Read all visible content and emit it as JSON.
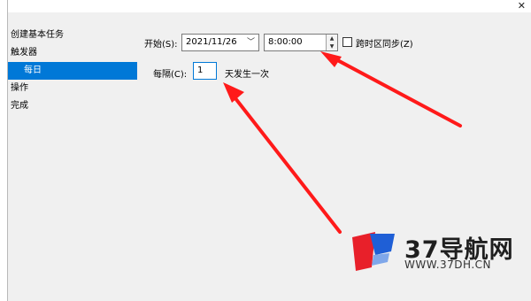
{
  "wizard": {
    "steps": [
      {
        "label": "创建基本任务"
      },
      {
        "label": "触发器"
      },
      {
        "label": "每日"
      },
      {
        "label": "操作"
      },
      {
        "label": "完成"
      }
    ],
    "selected_step": 2
  },
  "schedule": {
    "start_label": "开始(S):",
    "start_date": "2021/11/26",
    "start_time": "8:00:00",
    "sync_timezone_label": "跨时区同步(Z)",
    "sync_timezone_checked": false,
    "recur_label": "每隔(C):",
    "recur_value": "1",
    "recur_unit_label": "天发生一次"
  },
  "watermark": {
    "brand": "37导航网",
    "url": "WWW.37DH.CN"
  },
  "colors": {
    "selection": "#0078d7",
    "arrow": "#ff1a1a",
    "logo_red": "#e8202a",
    "logo_blue": "#1f5fd6"
  }
}
